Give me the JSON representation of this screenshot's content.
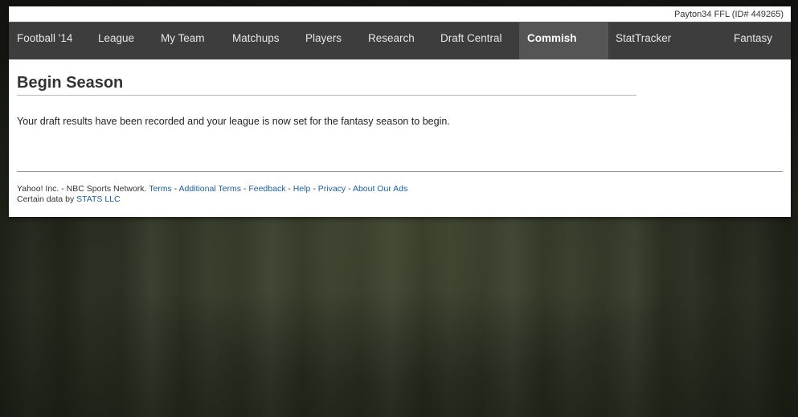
{
  "header": {
    "league_info": "Payton34 FFL (ID# 449265)"
  },
  "nav": {
    "items": [
      {
        "label": "Football '14",
        "active": false
      },
      {
        "label": "League",
        "active": false
      },
      {
        "label": "My Team",
        "active": false
      },
      {
        "label": "Matchups",
        "active": false
      },
      {
        "label": "Players",
        "active": false
      },
      {
        "label": "Research",
        "active": false
      },
      {
        "label": "Draft Central",
        "active": false
      },
      {
        "label": "Commish Tools",
        "active": true
      },
      {
        "label": "StatTracker",
        "active": false
      },
      {
        "label": "Fantasy",
        "active": false
      }
    ]
  },
  "main": {
    "title": "Begin Season",
    "message": "Your draft results have been recorded and your league is now set for the fantasy season to begin."
  },
  "footer": {
    "prefix": "Yahoo! Inc. - NBC Sports Network.",
    "sep": "-",
    "links": {
      "terms": "Terms",
      "additional_terms": "Additional Terms",
      "feedback": "Feedback",
      "help": "Help",
      "privacy": "Privacy",
      "about_ads": "About Our Ads"
    },
    "data_credit_prefix": "Certain data by",
    "data_credit_link": "STATS LLC"
  },
  "colors": {
    "nav_bg": "#3d3d3d",
    "nav_active_bg": "#555555",
    "link": "#1f5e94"
  }
}
